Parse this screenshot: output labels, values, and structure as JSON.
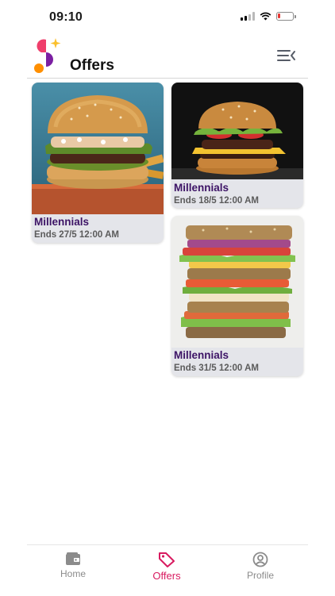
{
  "status_bar": {
    "time": "09:10"
  },
  "header": {
    "title": "Offers",
    "menu_icon": "menu-collapse-icon"
  },
  "offers": [
    {
      "name": "Millennials",
      "ends": "Ends 27/5 12:00 AM",
      "image": "burger-photo"
    },
    {
      "name": "Millennials",
      "ends": "Ends 18/5 12:00 AM",
      "image": "cheeseburger-photo"
    },
    {
      "name": "Millennials",
      "ends": "Ends 31/5 12:00 AM",
      "image": "sandwich-photo"
    }
  ],
  "tabs": [
    {
      "label": "Home",
      "icon": "wallet-icon",
      "active": false
    },
    {
      "label": "Offers",
      "icon": "tag-icon",
      "active": true
    },
    {
      "label": "Profile",
      "icon": "profile-icon",
      "active": false
    }
  ],
  "colors": {
    "accent": "#d81b60",
    "offer_name": "#3d1466",
    "card_bg": "#e4e5ea",
    "tab_inactive": "#8b8b8b"
  }
}
